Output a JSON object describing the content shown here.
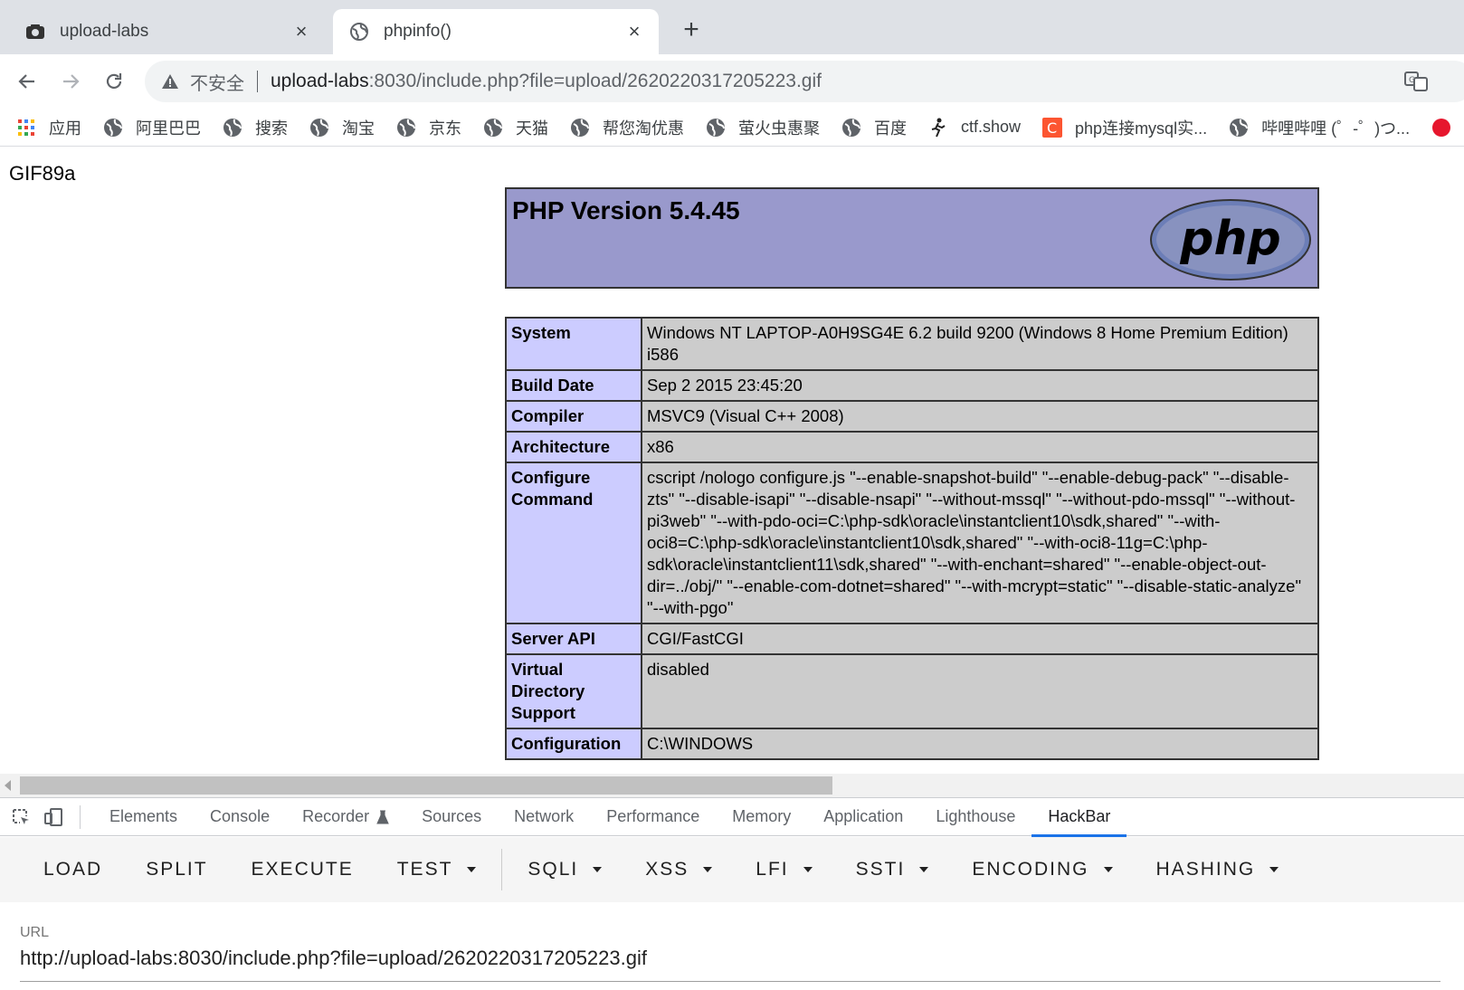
{
  "tabs": [
    {
      "title": "upload-labs",
      "close": "×"
    },
    {
      "title": "phpinfo()",
      "close": "×"
    }
  ],
  "new_tab": "+",
  "omnibox": {
    "security": "不安全",
    "host": "upload-labs",
    "rest": ":8030/include.php?file=upload/2620220317205223.gif"
  },
  "bookmarks": [
    "应用",
    "阿里巴巴",
    "搜索",
    "淘宝",
    "京东",
    "天猫",
    "帮您淘优惠",
    "萤火虫惠聚",
    "百度",
    "ctf.show",
    "php连接mysql实...",
    "哔哩哔哩 (゜-゜)つ..."
  ],
  "page": {
    "gif_header": "GIF89a",
    "php_version": "PHP Version 5.4.45",
    "logo_text": "php",
    "rows": [
      {
        "key": "System",
        "value": "Windows NT LAPTOP-A0H9SG4E 6.2 build 9200 (Windows 8 Home Premium Edition) i586"
      },
      {
        "key": "Build Date",
        "value": "Sep 2 2015 23:45:20"
      },
      {
        "key": "Compiler",
        "value": "MSVC9 (Visual C++ 2008)"
      },
      {
        "key": "Architecture",
        "value": "x86"
      },
      {
        "key": "Configure Command",
        "value": "cscript /nologo configure.js \"--enable-snapshot-build\" \"--enable-debug-pack\" \"--disable-zts\" \"--disable-isapi\" \"--disable-nsapi\" \"--without-mssql\" \"--without-pdo-mssql\" \"--without-pi3web\" \"--with-pdo-oci=C:\\php-sdk\\oracle\\instantclient10\\sdk,shared\" \"--with-oci8=C:\\php-sdk\\oracle\\instantclient10\\sdk,shared\" \"--with-oci8-11g=C:\\php-sdk\\oracle\\instantclient11\\sdk,shared\" \"--with-enchant=shared\" \"--enable-object-out-dir=../obj/\" \"--enable-com-dotnet=shared\" \"--with-mcrypt=static\" \"--disable-static-analyze\" \"--with-pgo\""
      },
      {
        "key": "Server API",
        "value": "CGI/FastCGI"
      },
      {
        "key": "Virtual Directory Support",
        "value": "disabled"
      },
      {
        "key": "Configuration",
        "value": "C:\\WINDOWS"
      }
    ]
  },
  "devtools": {
    "tabs": [
      "Elements",
      "Console",
      "Recorder",
      "Sources",
      "Network",
      "Performance",
      "Memory",
      "Application",
      "Lighthouse",
      "HackBar"
    ],
    "active_tab": "HackBar"
  },
  "hackbar": {
    "buttons": [
      "LOAD",
      "SPLIT",
      "EXECUTE"
    ],
    "dropdowns_left": [
      "TEST"
    ],
    "dropdowns_right": [
      "SQLI",
      "XSS",
      "LFI",
      "SSTI",
      "ENCODING",
      "HASHING"
    ],
    "url_label": "URL",
    "url_value": "http://upload-labs:8030/include.php?file=upload/2620220317205223.gif"
  },
  "colors": {
    "php_header": "#9999cc",
    "key_cell": "#ccccff",
    "value_cell": "#cccccc",
    "active_tab_underline": "#1a73e8"
  }
}
